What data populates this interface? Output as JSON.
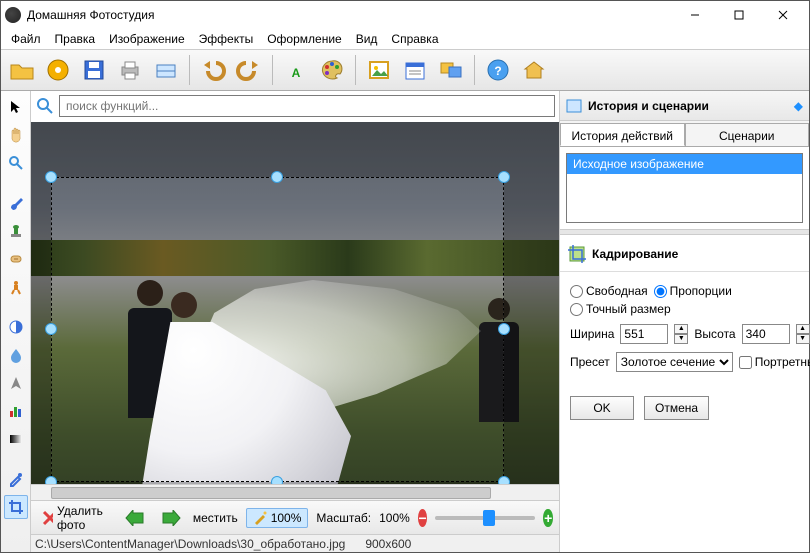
{
  "window": {
    "title": "Домашняя Фотостудия"
  },
  "menu": {
    "file": "Файл",
    "edit": "Правка",
    "image": "Изображение",
    "effects": "Эффекты",
    "design": "Оформление",
    "view": "Вид",
    "help": "Справка"
  },
  "search": {
    "placeholder": "поиск функций..."
  },
  "rightpanel": {
    "history_title": "История и сценарии",
    "tab_history": "История действий",
    "tab_scenarios": "Сценарии",
    "history_item0": "Исходное изображение",
    "crop_title": "Кадрирование",
    "mode_free": "Свободная",
    "mode_ratio": "Пропорции",
    "mode_exact": "Точный размер",
    "width_label": "Ширина",
    "width_value": "551",
    "height_label": "Высота",
    "height_value": "340",
    "preset_label": "Пресет",
    "preset_value": "Золотое сечение",
    "portrait_label": "Портретные",
    "ok": "OK",
    "cancel": "Отмена"
  },
  "bottombar": {
    "delete": "Удалить фото",
    "move": "местить",
    "auto": "100%",
    "scale_label": "Масштаб:",
    "scale_value": "100%"
  },
  "statusbar": {
    "path": "C:\\Users\\ContentManager\\Downloads\\30_обработано.jpg",
    "dims": "900x600"
  }
}
